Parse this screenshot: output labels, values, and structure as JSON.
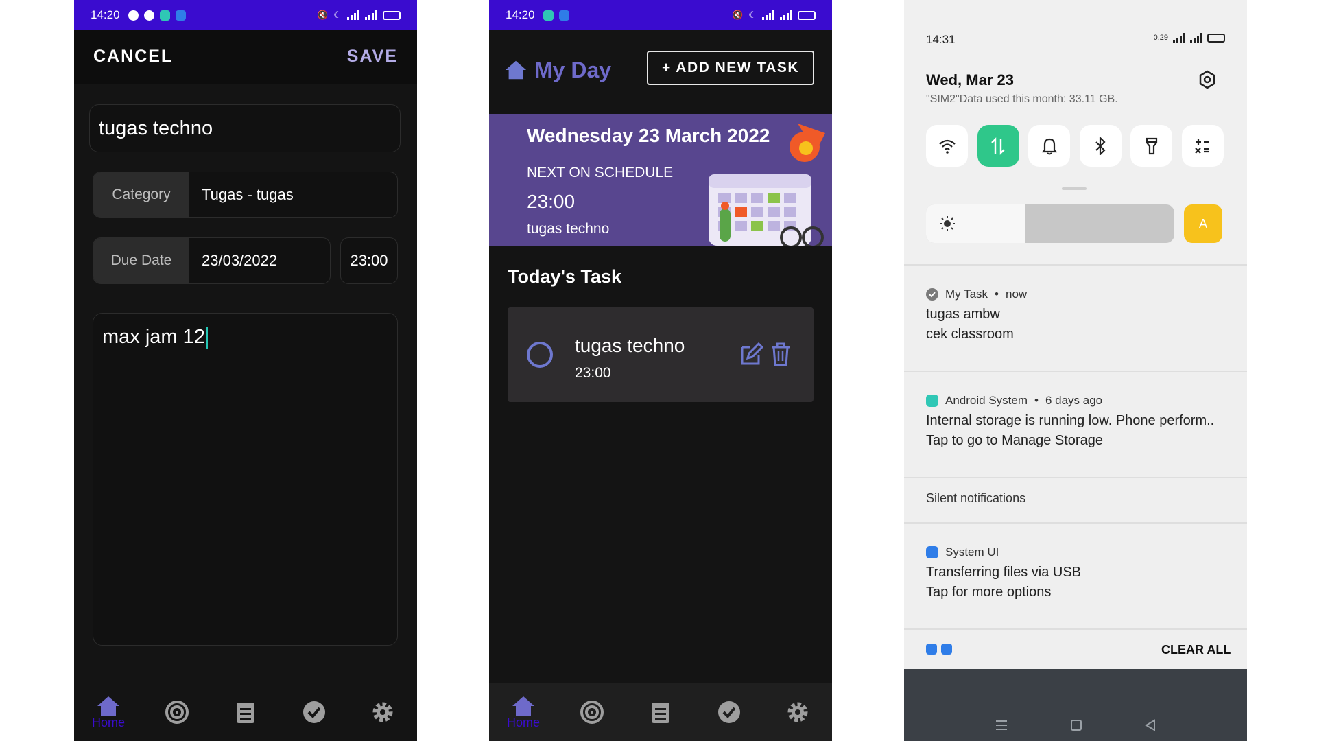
{
  "editor": {
    "status_time": "14:20",
    "cancel_label": "CANCEL",
    "save_label": "SAVE",
    "title_value": "tugas techno",
    "category_label": "Category",
    "category_value": "Tugas - tugas",
    "due_label": "Due Date",
    "due_value": "23/03/2022",
    "time_value": "23:00",
    "notes_value": "max jam 12",
    "nav_home_label": "Home"
  },
  "myday": {
    "status_time": "14:20",
    "title": "My Day",
    "add_button": "+ ADD NEW TASK",
    "banner_date": "Wednesday 23 March 2022",
    "banner_next": "NEXT ON SCHEDULE",
    "banner_time": "23:00",
    "banner_task": "tugas techno",
    "section_title": "Today's Task",
    "task_name": "tugas techno",
    "task_time": "23:00",
    "nav_home_label": "Home"
  },
  "shade": {
    "time": "14:31",
    "net_speed": "0.29",
    "date": "Wed, Mar 23",
    "data_usage": "\"SIM2\"Data used this month: 33.11 GB.",
    "auto_label": "A",
    "brightness": 0.4,
    "notifications": [
      {
        "app": "My Task",
        "when": "now",
        "line1": "tugas ambw",
        "line2": "cek classroom"
      },
      {
        "app": "Android System",
        "when": "6 days ago",
        "line1": "Internal storage is running low. Phone perform..",
        "line2": "Tap to go to Manage Storage"
      },
      {
        "app": "System UI",
        "line1": "Transferring files via USB",
        "line2": "Tap for more options"
      }
    ],
    "silent_header": "Silent notifications",
    "clear_all": "CLEAR ALL"
  },
  "colors": {
    "status_bar": "#3a0ccf",
    "accent_purple": "#6e6aca",
    "banner": "#58468f",
    "toggle_on": "#2fc78a",
    "auto_brightness": "#f7c21c"
  }
}
